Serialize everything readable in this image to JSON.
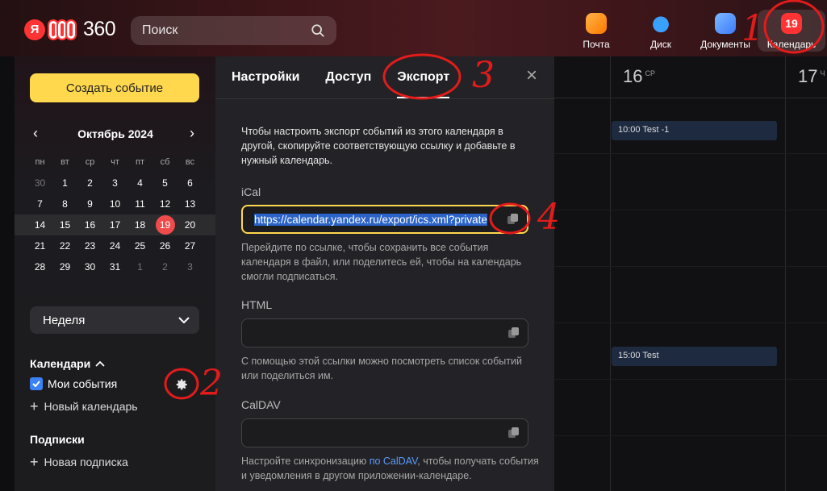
{
  "header": {
    "logo_ya": "Я",
    "logo_text": "360",
    "search": {
      "placeholder": "Поиск"
    },
    "apps": [
      {
        "label": "Почта",
        "icon": "mail-icon"
      },
      {
        "label": "Диск",
        "icon": "disk-icon"
      },
      {
        "label": "Документы",
        "icon": "docs-icon"
      },
      {
        "label": "Календарь",
        "icon": "calendar-icon",
        "badge": "19",
        "active": true
      }
    ]
  },
  "sidebar": {
    "create_button": "Создать событие",
    "mini_calendar": {
      "month": "Октябрь 2024",
      "prev": "‹",
      "next": "›",
      "weekdays": [
        "пн",
        "вт",
        "ср",
        "чт",
        "пт",
        "сб",
        "вс"
      ],
      "weeks": [
        [
          "30",
          "1",
          "2",
          "3",
          "4",
          "5",
          "6"
        ],
        [
          "7",
          "8",
          "9",
          "10",
          "11",
          "12",
          "13"
        ],
        [
          "14",
          "15",
          "16",
          "17",
          "18",
          "19",
          "20"
        ],
        [
          "21",
          "22",
          "23",
          "24",
          "25",
          "26",
          "27"
        ],
        [
          "28",
          "29",
          "30",
          "31",
          "1",
          "2",
          "3"
        ]
      ],
      "today": "19"
    },
    "view_select": "Неделя",
    "calendars_title": "Календари",
    "my_events": "Мои события",
    "new_calendar": "Новый календарь",
    "subscriptions_title": "Подписки",
    "new_subscription": "Новая подписка"
  },
  "panel": {
    "tabs": [
      "Настройки",
      "Доступ",
      "Экспорт"
    ],
    "active_tab": "Экспорт",
    "intro": "Чтобы настроить экспорт событий из этого календаря в другой, скопируйте соответствующую ссылку и добавьте в нужный календарь.",
    "ical_title": "iCal",
    "ical_url": "https://calendar.yandex.ru/export/ics.xml?private",
    "ical_hint": "Перейдите по ссылке, чтобы сохранить все события календаря в файл, или поделитесь ей, чтобы на календарь смогли подписаться.",
    "html_title": "HTML",
    "html_hint": "С помощью этой ссылки можно посмотреть список событий или поделиться им.",
    "caldav_title": "CalDAV",
    "caldav_hint_pre": "Настройте синхронизацию ",
    "caldav_hint_link": "по CalDAV",
    "caldav_hint_post": ", чтобы получать события и уведомления в другом приложении-календаре."
  },
  "week_view": {
    "days": [
      {
        "num": "16",
        "weekday": "СР"
      },
      {
        "num": "17",
        "weekday": "Ч"
      }
    ],
    "events": [
      {
        "label": "10:00 Test -1"
      },
      {
        "label": "15:00 Test"
      }
    ]
  },
  "annotations": [
    "1",
    "2",
    "3",
    "4"
  ],
  "colors": {
    "accent": "#ffd84d",
    "today": "#f04b4b",
    "link": "#5a9cff",
    "annotation": "#e21b1b"
  }
}
